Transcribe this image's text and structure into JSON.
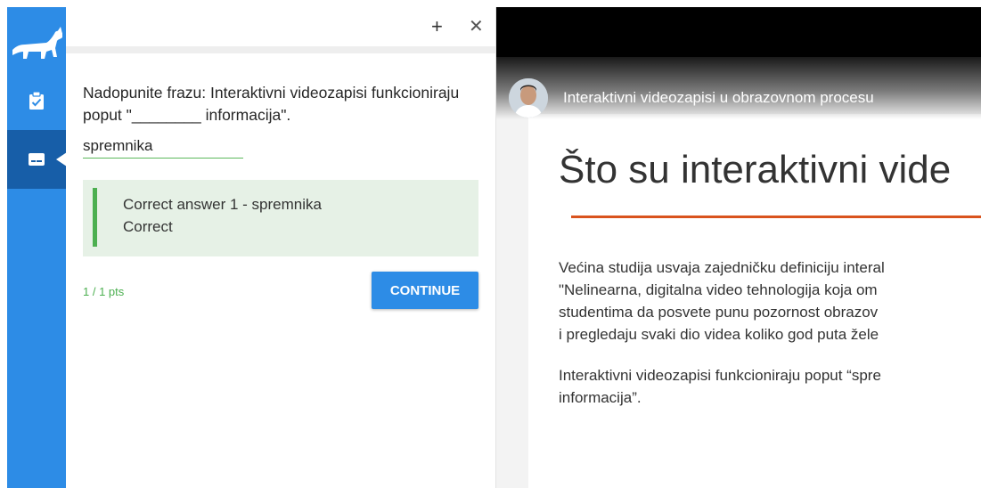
{
  "sidebar": {
    "logo_icon": "dog-icon",
    "items": [
      {
        "icon": "clipboard-check-icon",
        "active": false
      },
      {
        "icon": "subtitles-icon",
        "active": true
      }
    ]
  },
  "panel": {
    "question": "Nadopunite frazu: Interaktivni videozapisi funkcioniraju poput \"________ informacija\".",
    "answer_value": "spremnika",
    "feedback": {
      "line1": "Correct answer 1 - spremnika",
      "line2": "Correct"
    },
    "points": "1 / 1 pts",
    "continue_label": "CONTINUE"
  },
  "video": {
    "title": "Interaktivni videozapisi u obrazovnom procesu",
    "slide": {
      "heading": "Što su interaktivni vide",
      "lines": [
        "Većina studija usvaja zajedničku definiciju interal",
        "\"Nelinearna, digitalna video tehnologija koja om",
        "studentima da posvete punu pozornost obrazov",
        "i pregledaju svaki dio videa koliko god puta žele",
        "Interaktivni videozapisi funkcioniraju poput “spre",
        "informacija”."
      ]
    }
  },
  "colors": {
    "accent": "#2d8ce6",
    "accent_dark": "#175ea8",
    "success": "#4caf50",
    "feedback_bg": "#e6f1e6",
    "slide_rule": "#d9531e"
  }
}
